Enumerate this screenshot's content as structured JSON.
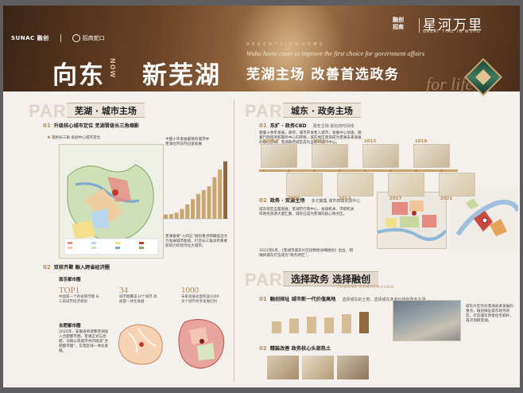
{
  "header": {
    "logo_sunac": "SUNAC 融创",
    "logo_partner": "招商蛇口",
    "title_left": "向东",
    "title_now": "NOW",
    "title_right": "新芜湖",
    "en_top": "R E G E N T   V I E W   H O M E",
    "en_line": "Wuhu home court to improve the first choice for government affairs",
    "slogan": "芜湖主场  改善首选政务",
    "brand_left_1": "融创",
    "brand_left_2": "招商",
    "brand_name": "星河万里",
    "brand_en": "GREAT TIME IN WUHU",
    "for_life": "for life"
  },
  "left": {
    "part": "PART 1",
    "section_title": "芜湖 · 城市主场",
    "s01_num": "01",
    "s01_title": "升级核心城市定位 芜湖晋级长三角缩影",
    "map_caption": "辐射长三角 省副中心城市定位",
    "chart_caption_1": "中国十年发展最快的城市中",
    "chart_caption_2": "芜湖位列前列迅速发展",
    "chart_note": "芜湖备受“十四五”规划重点明确提出大力发展城市能级，打造长三角具有重要影响力的现代化大城市。",
    "s02_num": "02",
    "s02_title": "双核齐聚 融入跨省经济圈",
    "nanjing_title": "南京都市圈",
    "stats": [
      {
        "value": "TOP1",
        "desc": "中国第一个跨省都市圈 长三角城市经济规划"
      },
      {
        "value": "34",
        "desc": "城市圈覆盖34个城市 高质量一体化发展"
      },
      {
        "value": "1000",
        "desc": "未来发展总面积逾1000 多个城市共享发展红利"
      }
    ],
    "hefei_title": "合肥都市圈",
    "hefei_note": "2020年，安徽省将调整芜湖加入合肥都市圈，芜湖正式与合肥、马鞍山等城市共同组成“合肥都市圈”，实现区域一体化发展。"
  },
  "chart_data": {
    "type": "bar",
    "values": [
      58,
      62,
      80,
      130,
      190,
      260,
      330,
      380,
      430,
      550,
      650,
      760
    ],
    "ylim": [
      0,
      800
    ],
    "data_labels": [
      "",
      "",
      "",
      "",
      "",
      "",
      "",
      "",
      "",
      "",
      "",
      "",
      ""
    ]
  },
  "right": {
    "part2": "PART 2",
    "section_title": "城东 · 政务主场",
    "s01_num": "01",
    "s01_title": "东扩 · 政务CBD",
    "s01_sub": "政务主场 进化的时间线",
    "s01_note": "随着十余年发展，政府、城市开发者入城市，发展中心加速。随着行政资源和服务中心的转移，城东地区逐渐成为芜湖未来发展的核心区域，芜湖政府城区成为全新的城市中心。",
    "timeline_years": [
      "2005.7",
      "2007",
      "2011",
      "2014",
      "2015",
      "2017",
      "2018",
      "2021"
    ],
    "s02_num": "02",
    "s02_title": "政务 · 资源主场",
    "s02_sub": "多元聚集 城市高端资源中心",
    "s02_note": "城东新区全面发展，芜湖市行政中心、省级机关、市级机关等政务资源大量汇聚，城东已成为芜湖的核心政务区。",
    "s02_note2": "2021年6月，《芜湖市城东片区控制性详细规划》出台，明确将城东打造成为“政务新区”。",
    "part3": "PART 3",
    "part3_title": "选择政务 选择融创",
    "part3_en": "CHOOSE RONGCHUANG",
    "p3_s01_num": "01",
    "p3_s01_title": "融创择址 城市新一代价值高地",
    "p3_s01_sub": "选择城东的土地、选择城东未来价值的政务主场",
    "p3_side_note": "城东片区作为芜湖未来发展的重点，融创择址城东政务新区，打造城东改善住宅标杆，再次领跑芜湖。",
    "p3_s02_num": "02",
    "p3_s02_title": "精装改善 政务核心头部热土"
  },
  "colors": {
    "accent": "#b38a57",
    "banner_dark": "#3a2415",
    "board": "#f4f1ec"
  }
}
